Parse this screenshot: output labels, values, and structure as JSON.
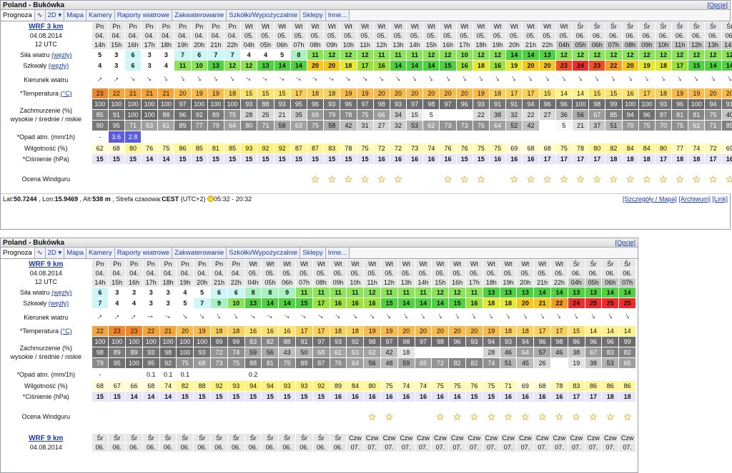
{
  "panels": [
    {
      "title": "Poland - Bukówka",
      "options": "[Opcje]",
      "tabs": [
        "Prognoza",
        "∿",
        "2D ▾",
        "Mapa",
        "Kamery",
        "Raporty wiatrowe",
        "Zakwaterowanie",
        "Szkółki/Wypożyczalnie",
        "Sklepy",
        "Inne..."
      ],
      "model": "WRF 3 km",
      "date": "04.08.2014",
      "utc": "12 UTC",
      "days": [
        "Pn",
        "Pn",
        "Pn",
        "Pn",
        "Pn",
        "Pn",
        "Pn",
        "Pn",
        "Pn",
        "Wt",
        "Wt",
        "Wt",
        "Wt",
        "Wt",
        "Wt",
        "Wt",
        "Wt",
        "Wt",
        "Wt",
        "Wt",
        "Wt",
        "Wt",
        "Wt",
        "Wt",
        "Wt",
        "Wt",
        "Wt",
        "Wt",
        "Wt",
        "Śr",
        "Śr",
        "Śr",
        "Śr",
        "Śr",
        "Śr",
        "Śr",
        "Śr",
        "Śr",
        "Śr"
      ],
      "dates": [
        "04.",
        "04.",
        "04.",
        "04.",
        "04.",
        "04.",
        "04.",
        "04.",
        "04.",
        "05.",
        "05.",
        "05.",
        "05.",
        "05.",
        "05.",
        "05.",
        "05.",
        "05.",
        "05.",
        "05.",
        "05.",
        "05.",
        "05.",
        "05.",
        "05.",
        "05.",
        "05.",
        "05.",
        "05.",
        "06.",
        "06.",
        "06.",
        "06.",
        "06.",
        "06.",
        "06.",
        "06.",
        "06.",
        "06."
      ],
      "hours": [
        "14h",
        "15h",
        "16h",
        "17h",
        "18h",
        "19h",
        "20h",
        "21h",
        "22h",
        "04h",
        "05h",
        "06h",
        "07h",
        "08h",
        "09h",
        "10h",
        "11h",
        "12h",
        "13h",
        "14h",
        "15h",
        "16h",
        "17h",
        "18h",
        "19h",
        "20h",
        "21h",
        "22h",
        "04h",
        "05h",
        "06h",
        "07h",
        "08h",
        "09h",
        "10h",
        "11h",
        "12h",
        "13h",
        "14h"
      ],
      "labels": {
        "wind": "Siła wiatru",
        "gust": "Szkwały",
        "unit": "(węzły)",
        "dir": "Kierunek wiatru",
        "temp": "*Temperatura",
        "cunit": "(°C)",
        "cloud1": "Zachmurzenie (%)",
        "cloud2": "wysokie / średnie / niskie",
        "rain": "*Opad atm. (mm/1h)",
        "hum": "Wilgotność (%)",
        "press": "*Ciśnienie (hPa)",
        "rating": "Ocena Windguru"
      },
      "wind": [
        "5",
        "3",
        "6",
        "3",
        "3",
        "7",
        "6",
        "7",
        "7",
        "4",
        "4",
        "5",
        "8",
        "11",
        "12",
        "12",
        "12",
        "11",
        "11",
        "11",
        "12",
        "12",
        "10",
        "12",
        "12",
        "14",
        "14",
        "13",
        "12",
        "12",
        "12",
        "12",
        "12",
        "12",
        "12",
        "12",
        "12",
        "12",
        "12"
      ],
      "gust": [
        "4",
        "3",
        "6",
        "3",
        "4",
        "11",
        "10",
        "13",
        "12",
        "12",
        "13",
        "14",
        "14",
        "20",
        "20",
        "18",
        "17",
        "16",
        "14",
        "14",
        "14",
        "15",
        "16",
        "18",
        "16",
        "19",
        "20",
        "20",
        "23",
        "24",
        "23",
        "22",
        "20",
        "19",
        "18",
        "17",
        "15",
        "14",
        "14"
      ],
      "dir": [
        225,
        225,
        315,
        315,
        330,
        330,
        330,
        330,
        330,
        300,
        300,
        300,
        300,
        300,
        300,
        310,
        310,
        320,
        320,
        330,
        330,
        330,
        330,
        330,
        330,
        330,
        330,
        330,
        330,
        330,
        330,
        330,
        330,
        330,
        330,
        330,
        330,
        330,
        330
      ],
      "temp": [
        "23",
        "22",
        "21",
        "21",
        "21",
        "20",
        "19",
        "19",
        "18",
        "15",
        "15",
        "15",
        "17",
        "18",
        "18",
        "19",
        "19",
        "20",
        "20",
        "20",
        "20",
        "20",
        "20",
        "19",
        "18",
        "17",
        "17",
        "15",
        "14",
        "14",
        "15",
        "15",
        "16",
        "17",
        "18",
        "19",
        "19",
        "20",
        "20"
      ],
      "cloud_h": [
        "100",
        "100",
        "100",
        "100",
        "100",
        "97",
        "100",
        "100",
        "100",
        "93",
        "88",
        "93",
        "95",
        "96",
        "93",
        "96",
        "97",
        "98",
        "93",
        "97",
        "98",
        "97",
        "96",
        "93",
        "91",
        "91",
        "94",
        "96",
        "96",
        "100",
        "98",
        "99",
        "100",
        "100",
        "93",
        "96",
        "100",
        "94",
        "91"
      ],
      "cloud_m": [
        "85",
        "91",
        "100",
        "100",
        "88",
        "96",
        "92",
        "89",
        "75",
        "28",
        "25",
        "21",
        "35",
        "69",
        "79",
        "78",
        "75",
        "66",
        "34",
        "15",
        "5",
        "",
        "",
        "22",
        "38",
        "32",
        "22",
        "27",
        "36",
        "56",
        "67",
        "85",
        "94",
        "96",
        "87",
        "81",
        "81",
        "75",
        "40"
      ],
      "cloud_l": [
        "90",
        "95",
        "71",
        "63",
        "61",
        "89",
        "77",
        "79",
        "64",
        "80",
        "71",
        "58",
        "63",
        "75",
        "58",
        "42",
        "31",
        "27",
        "32",
        "53",
        "62",
        "73",
        "73",
        "76",
        "64",
        "52",
        "42",
        "",
        "5",
        "21",
        "37",
        "51",
        "70",
        "75",
        "70",
        "75",
        "61",
        "71",
        "85"
      ],
      "rain": [
        "-",
        "3.6",
        "2.8",
        "",
        "",
        "",
        "",
        "",
        "",
        "",
        "",
        "",
        "",
        "",
        "",
        "",
        "",
        "",
        "",
        "",
        "",
        "",
        "",
        "",
        "",
        "",
        "",
        "",
        "",
        "",
        "",
        "",
        "",
        "",
        "",
        "",
        "",
        "",
        ""
      ],
      "hum": [
        "62",
        "68",
        "80",
        "76",
        "75",
        "86",
        "85",
        "81",
        "85",
        "93",
        "92",
        "92",
        "87",
        "87",
        "83",
        "78",
        "75",
        "72",
        "72",
        "73",
        "74",
        "76",
        "76",
        "75",
        "75",
        "69",
        "68",
        "68",
        "75",
        "78",
        "80",
        "82",
        "84",
        "84",
        "80",
        "77",
        "74",
        "72",
        "69"
      ],
      "press": [
        "15",
        "15",
        "15",
        "14",
        "14",
        "15",
        "15",
        "15",
        "15",
        "15",
        "15",
        "15",
        "15",
        "15",
        "15",
        "15",
        "15",
        "16",
        "16",
        "16",
        "16",
        "16",
        "15",
        "15",
        "16",
        "16",
        "16",
        "17",
        "17",
        "17",
        "17",
        "18",
        "18",
        "18",
        "17",
        "18",
        "18",
        "17",
        "16"
      ],
      "stars": [
        0,
        0,
        0,
        0,
        0,
        0,
        0,
        0,
        0,
        0,
        0,
        0,
        0,
        1,
        1,
        1,
        1,
        1,
        1,
        0,
        0,
        1,
        1,
        1,
        0,
        1,
        1,
        1,
        1,
        1,
        1,
        1,
        1,
        1,
        1,
        1,
        1,
        1,
        1
      ],
      "footer": {
        "lat_l": "Lat:",
        "lat": "50.7244",
        "lon_l": ", Lon:",
        "lon": "15.9469",
        "alt_l": ", Alt:",
        "alt": "538 m",
        "tz_l": ", Strefa czasowa:",
        "tz": "CEST",
        "tz2": "(UTC+2)",
        "sun": "05:32 - 20:32",
        "links": [
          "[Szczegóły / Mapa]",
          "[Archiwum]",
          "[Link]"
        ]
      }
    },
    {
      "title": "Poland - Bukówka",
      "options": "[Opcje]",
      "tabs": [
        "Prognoza",
        "∿",
        "2D ▾",
        "Mapa",
        "Kamery",
        "Raporty wiatrowe",
        "Zakwaterowanie",
        "Szkółki/Wypożyczalnie",
        "Sklepy",
        "Inne..."
      ],
      "model": "WRF 9 km",
      "date": "04.08.2014",
      "utc": "12 UTC",
      "days": [
        "Pn",
        "Pn",
        "Pn",
        "Pn",
        "Pn",
        "Pn",
        "Pn",
        "Pn",
        "Pn",
        "Wt",
        "Wt",
        "Wt",
        "Wt",
        "Wt",
        "Wt",
        "Wt",
        "Wt",
        "Wt",
        "Wt",
        "Wt",
        "Wt",
        "Wt",
        "Wt",
        "Wt",
        "Wt",
        "Wt",
        "Wt",
        "Wt",
        "Śr",
        "Śr",
        "Śr",
        "Śr"
      ],
      "dates": [
        "04.",
        "04.",
        "04.",
        "04.",
        "04.",
        "04.",
        "04.",
        "04.",
        "04.",
        "05.",
        "05.",
        "05.",
        "05.",
        "05.",
        "05.",
        "05.",
        "05.",
        "05.",
        "05.",
        "05.",
        "05.",
        "05.",
        "05.",
        "05.",
        "05.",
        "05.",
        "05.",
        "05.",
        "06.",
        "06.",
        "06.",
        "06."
      ],
      "hours": [
        "14h",
        "15h",
        "16h",
        "17h",
        "18h",
        "19h",
        "20h",
        "21h",
        "22h",
        "04h",
        "05h",
        "06h",
        "07h",
        "08h",
        "09h",
        "10h",
        "11h",
        "12h",
        "13h",
        "14h",
        "15h",
        "16h",
        "17h",
        "18h",
        "19h",
        "20h",
        "21h",
        "22h",
        "04h",
        "05h",
        "06h",
        "07h"
      ],
      "labels": {
        "wind": "Siła wiatru",
        "gust": "Szkwały",
        "unit": "(węzły)",
        "dir": "Kierunek wiatru",
        "temp": "*Temperatura",
        "cunit": "(°C)",
        "cloud1": "Zachmurzenie (%)",
        "cloud2": "wysokie / średnie / niskie",
        "rain": "*Opad atm. (mm/1h)",
        "hum": "Wilgotność (%)",
        "press": "*Ciśnienie (hPa)",
        "rating": "Ocena Windguru"
      },
      "wind": [
        "6",
        "3",
        "3",
        "3",
        "3",
        "4",
        "5",
        "6",
        "6",
        "8",
        "8",
        "9",
        "11",
        "11",
        "11",
        "11",
        "12",
        "11",
        "11",
        "11",
        "12",
        "12",
        "11",
        "13",
        "13",
        "13",
        "14",
        "14",
        "13",
        "13",
        "14",
        "14"
      ],
      "gust": [
        "7",
        "4",
        "4",
        "3",
        "3",
        "5",
        "7",
        "9",
        "10",
        "13",
        "14",
        "14",
        "15",
        "17",
        "16",
        "16",
        "16",
        "15",
        "14",
        "14",
        "14",
        "15",
        "16",
        "18",
        "18",
        "20",
        "21",
        "22",
        "24",
        "25",
        "25",
        "25"
      ],
      "dir": [
        225,
        225,
        230,
        270,
        290,
        320,
        320,
        330,
        330,
        300,
        300,
        300,
        300,
        305,
        310,
        320,
        320,
        325,
        330,
        330,
        330,
        330,
        330,
        330,
        330,
        330,
        330,
        330,
        330,
        330,
        330,
        330
      ],
      "temp": [
        "22",
        "23",
        "23",
        "22",
        "21",
        "20",
        "19",
        "18",
        "18",
        "16",
        "16",
        "16",
        "17",
        "17",
        "18",
        "18",
        "19",
        "19",
        "20",
        "20",
        "20",
        "20",
        "20",
        "19",
        "18",
        "18",
        "17",
        "17",
        "15",
        "14",
        "14",
        "14"
      ],
      "cloud_h": [
        "100",
        "100",
        "100",
        "100",
        "100",
        "100",
        "100",
        "99",
        "99",
        "83",
        "82",
        "88",
        "91",
        "97",
        "93",
        "92",
        "98",
        "97",
        "98",
        "97",
        "98",
        "96",
        "93",
        "94",
        "93",
        "94",
        "96",
        "98",
        "96",
        "96",
        "96",
        "99"
      ],
      "cloud_m": [
        "98",
        "89",
        "89",
        "93",
        "98",
        "100",
        "93",
        "72",
        "74",
        "59",
        "56",
        "43",
        "50",
        "68",
        "61",
        "63",
        "62",
        "42",
        "18",
        "",
        "",
        "",
        "",
        "28",
        "46",
        "64",
        "57",
        "46",
        "38",
        "67",
        "83",
        "82",
        "94"
      ],
      "cloud_l": [
        "79",
        "95",
        "100",
        "95",
        "92",
        "75",
        "68",
        "73",
        "75",
        "88",
        "81",
        "75",
        "89",
        "87",
        "76",
        "64",
        "56",
        "48",
        "59",
        "65",
        "72",
        "82",
        "82",
        "74",
        "51",
        "45",
        "26",
        "",
        "19",
        "38",
        "53",
        "65"
      ],
      "rain": [
        "-",
        "",
        "",
        "0.1",
        "0.1",
        "0.1",
        "",
        "",
        "",
        "0.2",
        "",
        "",
        "",
        "",
        "",
        "",
        "",
        "",
        "",
        "",
        "",
        "",
        "",
        "",
        "",
        "",
        "",
        "",
        "",
        "",
        "",
        ""
      ],
      "hum": [
        "68",
        "67",
        "66",
        "68",
        "74",
        "82",
        "88",
        "92",
        "93",
        "94",
        "94",
        "93",
        "93",
        "92",
        "89",
        "84",
        "80",
        "75",
        "74",
        "74",
        "75",
        "75",
        "76",
        "75",
        "71",
        "69",
        "68",
        "78",
        "83",
        "86",
        "86",
        "86"
      ],
      "press": [
        "15",
        "15",
        "14",
        "14",
        "14",
        "15",
        "15",
        "15",
        "15",
        "15",
        "15",
        "15",
        "15",
        "15",
        "16",
        "16",
        "16",
        "16",
        "16",
        "16",
        "16",
        "16",
        "15",
        "15",
        "16",
        "16",
        "16",
        "16",
        "17",
        "17",
        "18",
        "18"
      ],
      "stars": [
        0,
        0,
        0,
        0,
        0,
        0,
        0,
        0,
        0,
        0,
        0,
        0,
        0,
        0,
        0,
        0,
        1,
        1,
        0,
        0,
        1,
        1,
        1,
        1,
        1,
        1,
        1,
        1,
        1,
        1,
        1,
        1
      ]
    }
  ],
  "third_row": {
    "model": "WRF 9 km",
    "date": "04.08.2014",
    "days": [
      "Śr",
      "Śr",
      "Śr",
      "Śr",
      "Śr",
      "Śr",
      "Śr",
      "Śr",
      "Śr",
      "Śr",
      "Śr",
      "Śr",
      "Śr",
      "Śr",
      "Śr",
      "Czw",
      "Czw",
      "Czw",
      "Czw",
      "Czw",
      "Czw",
      "Czw",
      "Czw",
      "Czw",
      "Czw",
      "Czw",
      "Czw",
      "Czw",
      "Czw",
      "Czw",
      "Czw",
      "Czw"
    ],
    "dates": [
      "06.",
      "06.",
      "06.",
      "06.",
      "06.",
      "06.",
      "06.",
      "06.",
      "06.",
      "06.",
      "06.",
      "06.",
      "06.",
      "06.",
      "06.",
      "07.",
      "07.",
      "07.",
      "07.",
      "07.",
      "07.",
      "07.",
      "07.",
      "07.",
      "07.",
      "07.",
      "07.",
      "07.",
      "07.",
      "07.",
      "07.",
      "07."
    ]
  }
}
